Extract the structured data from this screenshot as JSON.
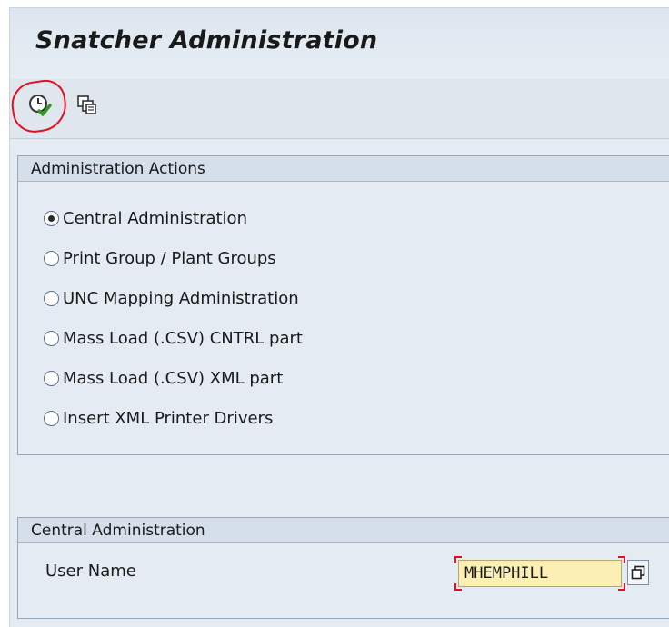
{
  "window": {
    "title": "Snatcher Administration"
  },
  "toolbar": {
    "execute_icon": "execute-clock-check-icon",
    "multiple_selection_icon": "multiple-selection-icon"
  },
  "actions_group": {
    "header": "Administration Actions",
    "options": [
      {
        "label": "Central Administration",
        "selected": true
      },
      {
        "label": "Print Group / Plant Groups",
        "selected": false
      },
      {
        "label": "UNC Mapping Administration",
        "selected": false
      },
      {
        "label": "Mass Load (.CSV) CNTRL part",
        "selected": false
      },
      {
        "label": "Mass Load (.CSV) XML part",
        "selected": false
      },
      {
        "label": "Insert XML Printer Drivers",
        "selected": false
      }
    ]
  },
  "central_group": {
    "header": "Central Administration",
    "user_name_label": "User Name",
    "user_name_value": "MHEMPHILL",
    "value_help_icon": "value-help-icon"
  },
  "colors": {
    "background": "#e4ebf2",
    "annotation_red": "#e3101f",
    "input_required": "#fcefb4"
  }
}
